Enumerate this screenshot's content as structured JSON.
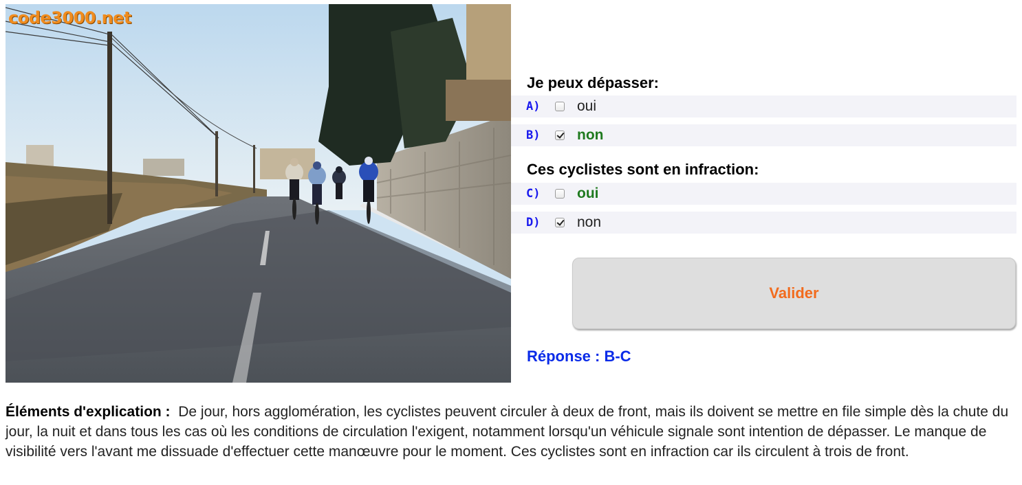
{
  "image": {
    "watermark": "code3000.net",
    "description_icon": "road-cyclists-photo"
  },
  "questions": [
    {
      "heading": "Je peux dépasser:",
      "options": [
        {
          "letter": "A)",
          "text": "oui",
          "checked": false,
          "correct": false
        },
        {
          "letter": "B)",
          "text": "non",
          "checked": true,
          "correct": true
        }
      ]
    },
    {
      "heading": "Ces cyclistes sont en infraction:",
      "options": [
        {
          "letter": "C)",
          "text": "oui",
          "checked": false,
          "correct": true
        },
        {
          "letter": "D)",
          "text": "non",
          "checked": true,
          "correct": false
        }
      ]
    }
  ],
  "validate_label": "Valider",
  "answer": "Réponse : B-C",
  "explanation": {
    "label": "Éléments d'explication :",
    "text": "De jour, hors agglomération, les cyclistes peuvent circuler à deux de front, mais ils doivent se mettre en file simple dès la chute du jour, la nuit et dans tous les cas où les conditions de circulation l'exigent, notamment lorsqu'un véhicule signale sont intention de dépasser. Le manque de visibilité vers l'avant me dissuade d'effectuer cette manœuvre pour le moment. Ces cyclistes sont en infraction car ils circulent à trois de front."
  },
  "colors": {
    "letter": "#1a1aee",
    "correct_option": "#1f7a1f",
    "validate_text": "#f26b1d",
    "answer": "#0a2be8",
    "watermark": "#f08c1e"
  }
}
